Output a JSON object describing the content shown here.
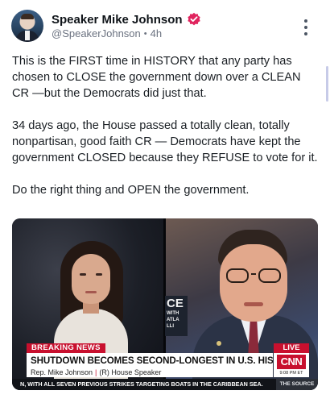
{
  "post": {
    "author_name": "Speaker Mike Johnson",
    "handle": "@SpeakerJohnson",
    "separator": "•",
    "time_ago": "4h",
    "verified_icon": "verified-badge-icon",
    "menu_icon": "more-vertical-icon",
    "paragraphs": [
      "This is the FIRST time in HISTORY that any party has chosen to CLOSE the government down over a CLEAN CR —but the Democrats did just that.",
      "34 days ago, the House passed a totally clean, totally nonpartisan, good faith CR — Democrats have kept the government CLOSED because they REFUSE to vote for it.",
      "Do the right thing and OPEN the government."
    ]
  },
  "video": {
    "breaking_label": "BREAKING NEWS",
    "live_label": "LIVE",
    "headline": "SHUTDOWN BECOMES SECOND-LONGEST IN U.S. HISTORY",
    "guest_name": "Rep. Mike Johnson",
    "guest_sep": "|",
    "guest_title": "(R) House Speaker",
    "network_logo": "CNN",
    "timestamp": "9:08 PM ET",
    "ticker": "N, WITH ALL SEVEN PREVIOUS STRIKES TARGETING BOATS IN THE CARIBBEAN SEA.",
    "ticker_source": "THE SOURCE",
    "backdrop_sign_big": "CE",
    "backdrop_sign_small": "WITH ATLA LLI"
  },
  "colors": {
    "accent_red": "#c8102e",
    "verified_pink": "#e0245e",
    "text_primary": "#0f1419",
    "text_secondary": "#6b7280"
  }
}
